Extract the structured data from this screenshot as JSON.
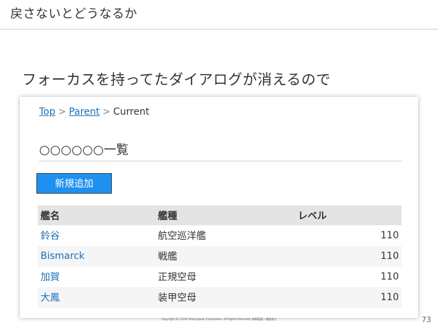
{
  "slide": {
    "title": "戻さないとどうなるか",
    "subtitle": "フォーカスを持ってたダイアログが消えるので",
    "page_number": "73",
    "copyright": "Copyright (C) 2016 Yahoo Japan Corporation. All Rights Reserved. 無断転載・複製禁止"
  },
  "breadcrumb": {
    "top": "Top",
    "parent": "Parent",
    "current": "Current",
    "separator": ">"
  },
  "page": {
    "heading": "○○○○○○一覧",
    "add_button": "新規追加"
  },
  "table": {
    "headers": [
      "艦名",
      "艦種",
      "レベル"
    ],
    "rows": [
      {
        "name": "鈴谷",
        "type": "航空巡洋艦",
        "level": "110"
      },
      {
        "name": "Bismarck",
        "type": "戦艦",
        "level": "110"
      },
      {
        "name": "加賀",
        "type": "正規空母",
        "level": "110"
      },
      {
        "name": "大鳳",
        "type": "装甲空母",
        "level": "110"
      }
    ]
  }
}
